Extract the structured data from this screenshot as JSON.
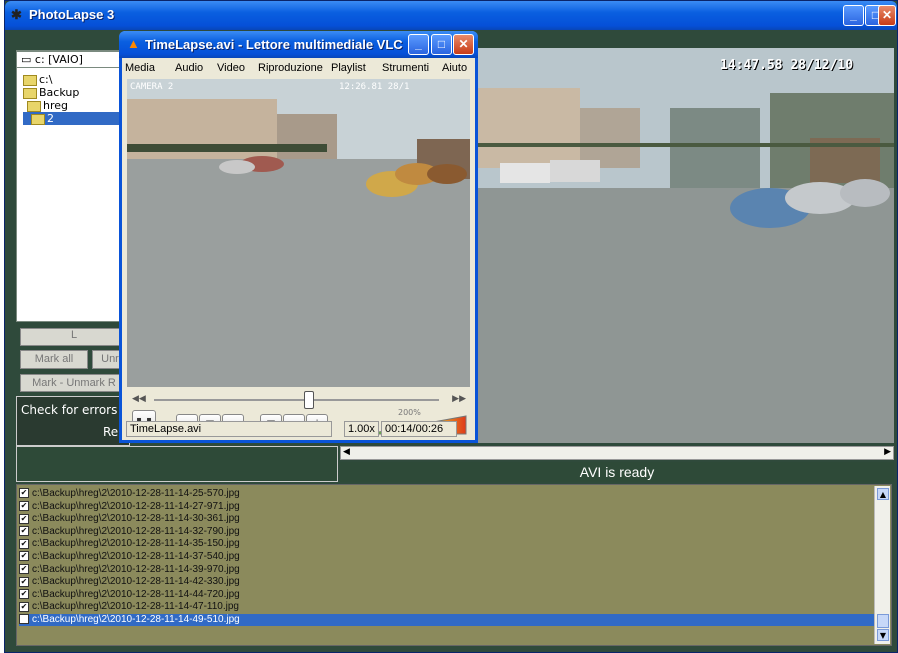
{
  "photolapse": {
    "title": "PhotoLapse 3",
    "drive": "c: [VAIO]",
    "tree": [
      "c:\\",
      "Backup",
      "hreg",
      "2"
    ],
    "buttons": {
      "load": "L",
      "mark_all": "Mark all",
      "unmark": "Unr",
      "mark_unmark": "Mark - Unmark R"
    },
    "check_text": "Check for errors v",
    "re_text": "Re",
    "status": "AVI is ready",
    "video_timestamp": "14:47.58 28/12/10",
    "files": [
      "c:\\Backup\\hreg\\2\\2010-12-28-11-14-25-570.jpg",
      "c:\\Backup\\hreg\\2\\2010-12-28-11-14-27-971.jpg",
      "c:\\Backup\\hreg\\2\\2010-12-28-11-14-30-361.jpg",
      "c:\\Backup\\hreg\\2\\2010-12-28-11-14-32-790.jpg",
      "c:\\Backup\\hreg\\2\\2010-12-28-11-14-35-150.jpg",
      "c:\\Backup\\hreg\\2\\2010-12-28-11-14-37-540.jpg",
      "c:\\Backup\\hreg\\2\\2010-12-28-11-14-39-970.jpg",
      "c:\\Backup\\hreg\\2\\2010-12-28-11-14-42-330.jpg",
      "c:\\Backup\\hreg\\2\\2010-12-28-11-14-44-720.jpg",
      "c:\\Backup\\hreg\\2\\2010-12-28-11-14-47-110.jpg",
      "c:\\Backup\\hreg\\2\\2010-12-28-11-14-49-510.jpg"
    ],
    "selected_file_index": 10
  },
  "vlc": {
    "title": "TimeLapse.avi - Lettore multimediale VLC",
    "menu": [
      "Media",
      "Audio",
      "Video",
      "Riproduzione",
      "Playlist",
      "Strumenti",
      "Aiuto"
    ],
    "overlay_camera": "CAMERA 2",
    "overlay_time": "12:26.81 28/1",
    "volume_label": "200%",
    "filename": "TimeLapse.avi",
    "speed": "1.00x",
    "time": "00:14/00:26",
    "seek_fraction": 0.54
  },
  "colors": {
    "title_blue": "#0a5fe0",
    "panel_green": "#2e4a38",
    "list_olive": "#8b8a5c",
    "selection": "#316ac5"
  }
}
